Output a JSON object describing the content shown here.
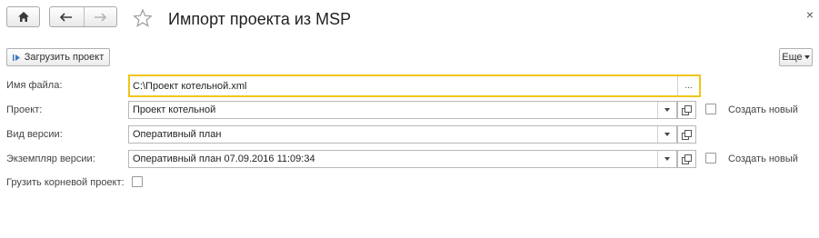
{
  "header": {
    "title": "Импорт проекта из MSP",
    "close_glyph": "×"
  },
  "toolbar": {
    "load_project_label": "Загрузить проект",
    "more_label": "Еще"
  },
  "form": {
    "file_name": {
      "label": "Имя файла:",
      "value": "C:\\Проект котельной.xml",
      "select_button": "..."
    },
    "project": {
      "label": "Проект:",
      "value": "Проект котельной",
      "create_new_label": "Создать новый",
      "create_new_checked": false
    },
    "version_type": {
      "label": "Вид версии:",
      "value": "Оперативный план"
    },
    "version_instance": {
      "label": "Экземпляр версии:",
      "value": "Оперативный план 07.09.2016 11:09:34",
      "create_new_label": "Создать новый",
      "create_new_checked": false
    },
    "load_root_project": {
      "label": "Грузить корневой проект:",
      "checked": false
    }
  },
  "colors": {
    "focus_border": "#f0c51a",
    "field_border": "#b8b8b8",
    "title_text": "#222222"
  },
  "icons": [
    "home-icon",
    "back-arrow-icon",
    "forward-arrow-icon",
    "star-icon",
    "close-icon",
    "load-project-icon",
    "chevron-down-icon",
    "open-form-icon"
  ]
}
